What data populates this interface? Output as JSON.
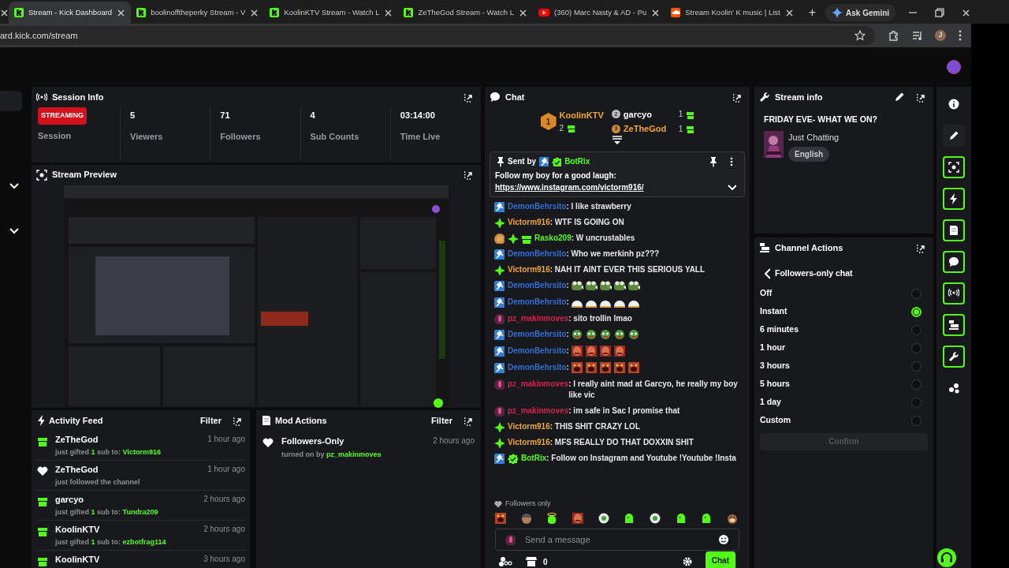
{
  "browser": {
    "tabs": [
      {
        "title": "Stream - Kick Dashboard",
        "selected": true,
        "kind": "kick"
      },
      {
        "title": "boolinofftheperky Stream - V",
        "selected": false,
        "kind": "kick"
      },
      {
        "title": "KoolinKTV Stream - Watch L",
        "selected": false,
        "kind": "kick"
      },
      {
        "title": "ZeTheGod Stream - Watch L",
        "selected": false,
        "kind": "kick"
      },
      {
        "title": "(360) Marc Nasty & AD - Pu",
        "selected": false,
        "kind": "youtube"
      },
      {
        "title": "Stream Koolin' K music | List",
        "selected": false,
        "kind": "soundcloud"
      }
    ],
    "new_tab": "+",
    "gemini": "Ask Gemini",
    "url": "ard.kick.com/stream",
    "profile": "J"
  },
  "session_info": {
    "title": "Session Info",
    "status": "STREAMING",
    "status_label": "Session",
    "stats": [
      {
        "value": "5",
        "label": "Viewers"
      },
      {
        "value": "71",
        "label": "Followers"
      },
      {
        "value": "4",
        "label": "Sub Counts"
      },
      {
        "value": "03:14:00",
        "label": "Time Live"
      }
    ]
  },
  "stream_preview": {
    "title": "Stream Preview"
  },
  "activity_feed": {
    "title": "Activity Feed",
    "filter": "Filter",
    "items": [
      {
        "kind": "gift",
        "user": "ZeTheGod",
        "time": "1 hour ago",
        "prefix": "just gifted",
        "count": "1",
        "middle": "sub to:",
        "recipient": "Victorm916"
      },
      {
        "kind": "follow",
        "user": "ZeTheGod",
        "time": "1 hour ago",
        "prefix": "just followed the channel"
      },
      {
        "kind": "gift",
        "user": "garcyo",
        "time": "2 hours ago",
        "prefix": "just gifted",
        "count": "1",
        "middle": "sub to:",
        "recipient": "Tundra209"
      },
      {
        "kind": "gift",
        "user": "KoolinKTV",
        "time": "2 hours ago",
        "prefix": "just gifted",
        "count": "1",
        "middle": "sub to:",
        "recipient": "ezbotfrag114"
      },
      {
        "kind": "gift",
        "user": "KoolinKTV",
        "time": "3 hours ago"
      }
    ]
  },
  "mod_actions": {
    "title": "Mod Actions",
    "filter": "Filter",
    "items": [
      {
        "title": "Followers-Only",
        "time": "2 hours ago",
        "prefix": "turned on by",
        "user": "pz_makinmoves"
      }
    ]
  },
  "chat": {
    "title": "Chat",
    "leaderboard": [
      {
        "rank": "1",
        "user": "KoolinKTV",
        "count": "2"
      },
      {
        "rank": "2",
        "user": "garcyo",
        "count": "1"
      },
      {
        "rank": "3",
        "user": "ZeTheGod",
        "count": "1"
      }
    ],
    "pinned": {
      "label": "Sent by",
      "user": "BotRix",
      "text": "Follow my boy for a good laugh:",
      "link": "https://www.instagram.com/victorm916/"
    },
    "messages": [
      {
        "user": "DemonBehrsito",
        "color": "#2f6fd6",
        "badges": [
          {
            "kind": "mod"
          }
        ],
        "text": ": I like strawberry"
      },
      {
        "user": "Victorm916",
        "color": "#f5a623",
        "badges": [
          {
            "kind": "vip"
          }
        ],
        "text": ": WTF IS GOING ON"
      },
      {
        "user": "Rasko209",
        "color": "#53fc18",
        "badges": [
          {
            "kind": "rank"
          },
          {
            "kind": "vip"
          },
          {
            "kind": "gift"
          }
        ],
        "text": ": W uncrustables"
      },
      {
        "user": "DemonBehrsito",
        "color": "#2f6fd6",
        "badges": [
          {
            "kind": "mod"
          }
        ],
        "text": ": Who we merkinh pz???"
      },
      {
        "user": "Victorm916",
        "color": "#f5a623",
        "badges": [
          {
            "kind": "vip"
          }
        ],
        "text": ": NAH IT AINT EVER THIS SERIOUS YALL"
      },
      {
        "user": "DemonBehrsito",
        "color": "#2f6fd6",
        "badges": [
          {
            "kind": "mod"
          }
        ],
        "text": ":",
        "emotes": [
          {
            "kind": "frog"
          },
          {
            "kind": "frog"
          },
          {
            "kind": "frog"
          },
          {
            "kind": "frog"
          },
          {
            "kind": "frog"
          }
        ]
      },
      {
        "user": "DemonBehrsito",
        "color": "#2f6fd6",
        "badges": [
          {
            "kind": "mod"
          }
        ],
        "text": ":",
        "emotes": [
          {
            "kind": "bun"
          },
          {
            "kind": "bun"
          },
          {
            "kind": "bun"
          },
          {
            "kind": "bun"
          },
          {
            "kind": "bun"
          }
        ]
      },
      {
        "user": "pz_makinmoves",
        "color": "#d0214c",
        "badges": [
          {
            "kind": "mic"
          }
        ],
        "text": ": sito trollin lmao"
      },
      {
        "user": "DemonBehrsito",
        "color": "#2f6fd6",
        "badges": [
          {
            "kind": "mod"
          }
        ],
        "text": ":",
        "emotes": [
          {
            "kind": "pepe"
          },
          {
            "kind": "pepe"
          },
          {
            "kind": "pepe"
          },
          {
            "kind": "pepe"
          },
          {
            "kind": "pepe"
          }
        ]
      },
      {
        "user": "DemonBehrsito",
        "color": "#2f6fd6",
        "badges": [
          {
            "kind": "mod"
          }
        ],
        "text": ":",
        "emotes": [
          {
            "kind": "face"
          },
          {
            "kind": "face"
          },
          {
            "kind": "face"
          },
          {
            "kind": "face"
          }
        ]
      },
      {
        "user": "DemonBehrsito",
        "color": "#2f6fd6",
        "badges": [
          {
            "kind": "mod"
          }
        ],
        "text": ":",
        "emotes": [
          {
            "kind": "shout"
          },
          {
            "kind": "shout"
          },
          {
            "kind": "shout"
          },
          {
            "kind": "shout"
          },
          {
            "kind": "shout"
          }
        ]
      },
      {
        "user": "pz_makinmoves",
        "color": "#d0214c",
        "badges": [
          {
            "kind": "mic"
          }
        ],
        "text": ": I really aint mad at Garcyo, he really my boy like vic"
      },
      {
        "user": "pz_makinmoves",
        "color": "#d0214c",
        "badges": [
          {
            "kind": "mic"
          }
        ],
        "text": ": im safe in Sac I promise that"
      },
      {
        "user": "Victorm916",
        "color": "#f5a623",
        "badges": [
          {
            "kind": "vip"
          }
        ],
        "text": ": THIS SHIT CRAZY LOL"
      },
      {
        "user": "Victorm916",
        "color": "#f5a623",
        "badges": [
          {
            "kind": "vip"
          }
        ],
        "text": ": MFS REALLY DO THAT DOXXIN SHIT"
      },
      {
        "user": "BotRix",
        "color": "#53fc18",
        "badges": [
          {
            "kind": "mod"
          },
          {
            "kind": "verified"
          }
        ],
        "text": ": Follow on Instagram and Youtube !Youtube !Insta"
      }
    ],
    "followers_only": "Followers only",
    "emote_bar": [
      {
        "kind": "shout"
      },
      {
        "kind": "hat"
      },
      {
        "kind": "halo"
      },
      {
        "kind": "face"
      },
      {
        "kind": "ball"
      },
      {
        "kind": "blob"
      },
      {
        "kind": "ball"
      },
      {
        "kind": "blob"
      },
      {
        "kind": "blob"
      },
      {
        "kind": "monkey"
      }
    ],
    "input": {
      "placeholder": "Send a message"
    },
    "footer": {
      "count": "0",
      "send": "Chat"
    }
  },
  "stream_info": {
    "title": "Stream info",
    "stream_title": "FRIDAY EVE- WHAT WE ON?",
    "category": "Just Chatting",
    "language": "English"
  },
  "channel_actions": {
    "title": "Channel Actions",
    "back": "Followers-only chat",
    "options": [
      {
        "label": "Off",
        "selected": false
      },
      {
        "label": "Instant",
        "selected": true
      },
      {
        "label": "6 minutes",
        "selected": false
      },
      {
        "label": "1 hour",
        "selected": false
      },
      {
        "label": "3 hours",
        "selected": false
      },
      {
        "label": "5 hours",
        "selected": false
      },
      {
        "label": "1 day",
        "selected": false
      },
      {
        "label": "Custom",
        "selected": false
      }
    ],
    "confirm": "Confirm",
    "confirm_disabled": true
  },
  "rail": [
    {
      "kind": "info",
      "highlighted": false
    },
    {
      "kind": "pencil",
      "highlighted": false
    },
    {
      "kind": "screen",
      "highlighted": true
    },
    {
      "kind": "bolt",
      "highlighted": true
    },
    {
      "kind": "doc",
      "highlighted": true
    },
    {
      "kind": "chat",
      "highlighted": true
    },
    {
      "kind": "broadcast",
      "highlighted": true
    },
    {
      "kind": "actions",
      "highlighted": true
    },
    {
      "kind": "wrench",
      "highlighted": true
    },
    {
      "kind": "dots",
      "highlighted": false
    }
  ]
}
